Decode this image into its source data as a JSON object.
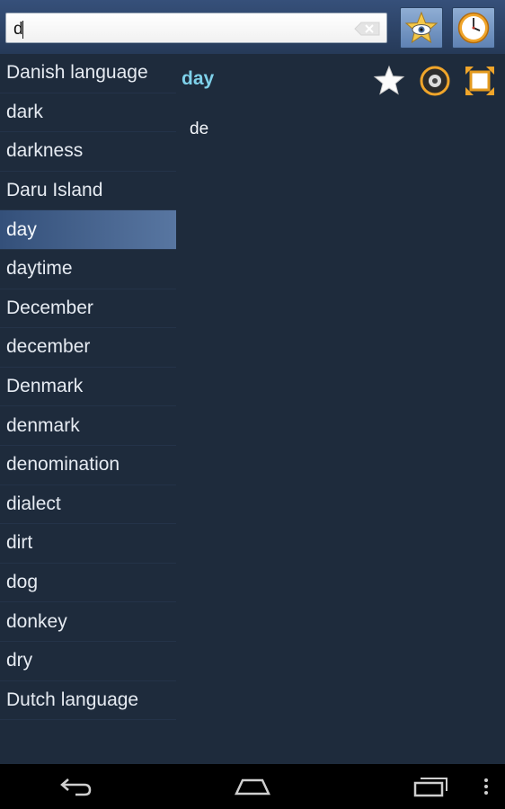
{
  "search": {
    "value": "d"
  },
  "toolbar": {
    "favorites_icon": "star-eye-icon",
    "history_icon": "clock-icon"
  },
  "word_list": [
    {
      "label": "Danish language"
    },
    {
      "label": "dark"
    },
    {
      "label": "darkness"
    },
    {
      "label": "Daru Island"
    },
    {
      "label": "day",
      "selected": true
    },
    {
      "label": "daytime"
    },
    {
      "label": "December"
    },
    {
      "label": "december"
    },
    {
      "label": "Denmark"
    },
    {
      "label": "denmark"
    },
    {
      "label": "denomination"
    },
    {
      "label": "dialect"
    },
    {
      "label": "dirt"
    },
    {
      "label": "dog"
    },
    {
      "label": "donkey"
    },
    {
      "label": "dry"
    },
    {
      "label": "Dutch language"
    }
  ],
  "detail": {
    "word": "day",
    "translation": "de"
  },
  "colors": {
    "accent": "#7fd1ea",
    "background": "#1e2b3c",
    "selected": "#4a6792"
  }
}
